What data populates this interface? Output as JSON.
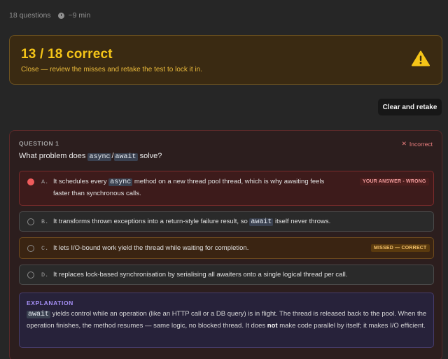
{
  "meta": {
    "questions": "18 questions",
    "time": "~9 min"
  },
  "score": {
    "title": "13 / 18 correct",
    "subtitle": "Close — review the misses and retake the test to lock it in.",
    "icon": "warning-triangle-icon",
    "accent_color": "#f5c518"
  },
  "retake_button": "Clear and retake",
  "question": {
    "label": "QUESTION 1",
    "status": "Incorrect",
    "status_color": "#f08080",
    "prompt_pre": "What problem does ",
    "prompt_code1": "async",
    "prompt_sep": "/",
    "prompt_code2": "await",
    "prompt_post": " solve?",
    "options": [
      {
        "letter": "A.",
        "text_pre": "It schedules every ",
        "text_code": "async",
        "text_post": " method on a new thread pool thread, which is why awaiting feels faster than synchronous calls.",
        "badge": "YOUR ANSWER - WRONG",
        "state": "selected-wrong"
      },
      {
        "letter": "B.",
        "text_pre": "It transforms thrown exceptions into a return-style failure result, so ",
        "text_code": "await",
        "text_post": " itself never throws.",
        "state": "unselected"
      },
      {
        "letter": "C.",
        "text": "It lets I/O-bound work yield the thread while waiting for completion.",
        "badge": "MISSED — CORRECT",
        "state": "missed-correct"
      },
      {
        "letter": "D.",
        "text": "It replaces lock-based synchronisation by serialising all awaiters onto a single logical thread per call.",
        "state": "unselected"
      }
    ],
    "explanation": {
      "label": "EXPLANATION",
      "code": "await",
      "text_1": " yields control while an operation (like an HTTP call or a DB query) is in flight. The thread is released back to the pool. When the operation finishes, the method resumes — same logic, no blocked thread. It does ",
      "bold": "not",
      "text_2": " make code parallel by itself; it makes I/O efficient."
    }
  }
}
